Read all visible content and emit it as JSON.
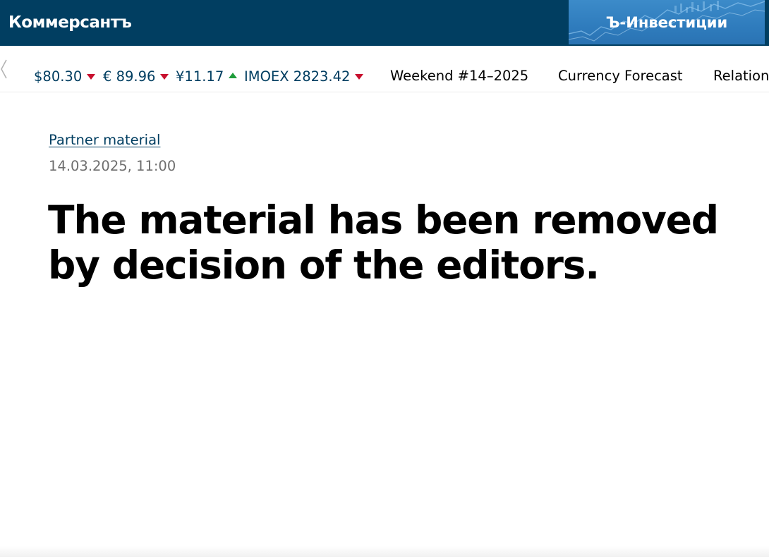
{
  "header": {
    "logo_text": "Коммерсантъ",
    "invest_banner_text": "Ъ-Инвестиции",
    "bg_color": "#013e61"
  },
  "tickers": [
    {
      "label": "$80.30",
      "trend": "down"
    },
    {
      "label": "€ 89.96",
      "trend": "down"
    },
    {
      "label": "¥11.17",
      "trend": "up"
    },
    {
      "label": "IMOEX 2823.42",
      "trend": "down"
    }
  ],
  "nav_links": [
    "Weekend #14–2025",
    "Currency Forecast",
    "Relation"
  ],
  "article": {
    "category": "Partner material",
    "date": "14.03.2025, 11:00",
    "headline": "The material has been removed by decision of the editors."
  },
  "colors": {
    "accent": "#013e61",
    "down": "#c8102e",
    "up": "#1f9c3a",
    "date_gray": "#6e6e6e"
  }
}
